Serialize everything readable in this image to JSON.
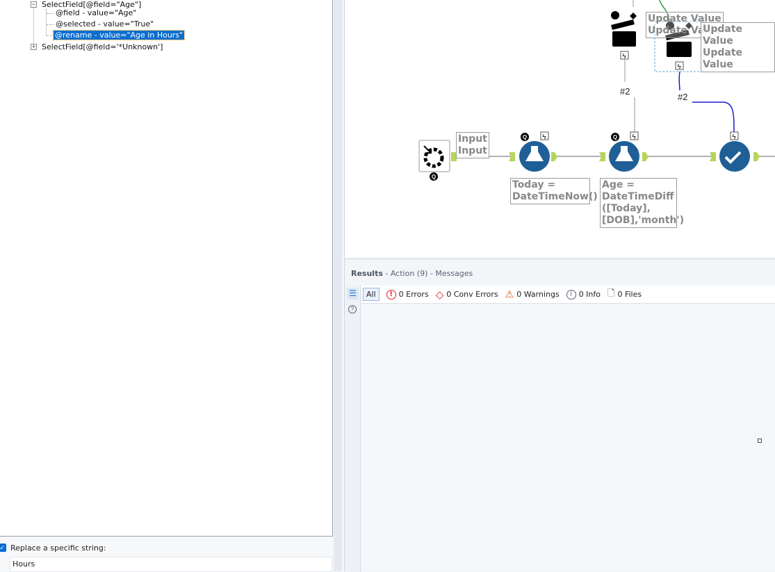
{
  "tree": {
    "parent": "SelectField[@field=\"Age\"]",
    "children": [
      "@field - value=\"Age\"",
      "@selected - value=\"True\"",
      "@rename - value=\"Age in Hours\""
    ],
    "sibling": "SelectField[@field='*Unknown']"
  },
  "options": {
    "replace_label": "Replace a specific string:",
    "replace_checked": true,
    "replace_value": "Hours"
  },
  "canvas": {
    "input_label": [
      "Input",
      "Input"
    ],
    "formula1_label": "Today = DateTimeNow()",
    "formula2_label": "Age = DateTimeDiff ([Today], [DOB],'month')",
    "update1_label": [
      "Update Value",
      "Update Value"
    ],
    "update2_label": [
      "Update Value",
      "Update Value"
    ],
    "conn1": "#2",
    "conn2": "#2"
  },
  "results": {
    "title": "Results",
    "subtitle": " - Action (9) - Messages",
    "filters": {
      "all": "All",
      "errors": "0 Errors",
      "conv": "0 Conv Errors",
      "warnings": "0 Warnings",
      "info": "0 Info",
      "files": "0 Files"
    }
  },
  "colors": {
    "accent": "#0a6ed1",
    "tool_blue": "#1f5f96",
    "anchor_green": "#b5d65a",
    "error": "#d9262c",
    "warning": "#e05a1e"
  }
}
